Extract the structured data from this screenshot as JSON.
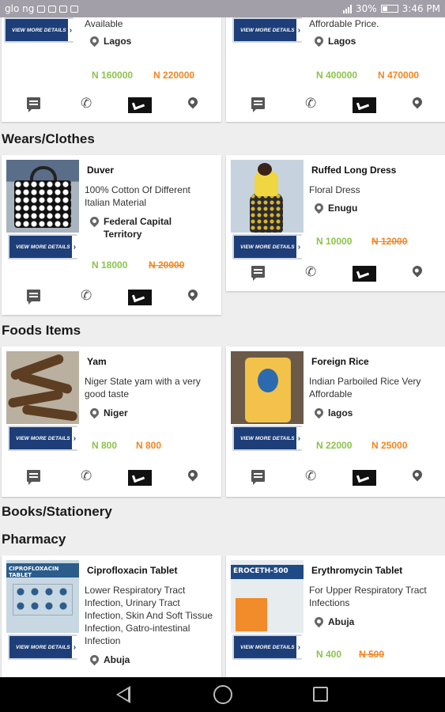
{
  "status_bar": {
    "carrier": "glo ng",
    "battery": "30%",
    "time": "3:46 PM"
  },
  "view_more_label": "VIEW MORE DETAILS",
  "sections": {
    "wears": "Wears/Clothes",
    "foods": "Foods Items",
    "books": "Books/Stationery",
    "pharmacy": "Pharmacy"
  },
  "top_cards": [
    {
      "desc": "Available",
      "location": "Lagos",
      "price": "N 160000",
      "old_price": "N 220000"
    },
    {
      "desc": "Affordable Price.",
      "location": "Lagos",
      "price": "N 400000",
      "old_price": "N 470000"
    }
  ],
  "wears_cards": [
    {
      "title": "Duver",
      "desc": "100% Cotton Of Different Italian Material",
      "location": "Federal Capital Territory",
      "price": "N 18000",
      "old_price": "N 20000",
      "image": "polka-dot-bag"
    },
    {
      "title": "Ruffed Long Dress",
      "desc": "Floral Dress",
      "location": "Enugu",
      "price": "N 10000",
      "old_price": "N 12000",
      "image": "yellow-dress"
    }
  ],
  "food_cards": [
    {
      "title": "Yam",
      "desc": "Niger State yam with a very good taste",
      "location": "Niger",
      "price": "N 800",
      "old_price": "N 800",
      "image": "yam-tubers"
    },
    {
      "title": "Foreign Rice",
      "desc": "Indian Parboiled Rice Very Affordable",
      "location": "lagos",
      "price": "N 22000",
      "old_price": "N 25000",
      "image": "rice-bag"
    }
  ],
  "pharmacy_cards": [
    {
      "title": "Ciprofloxacin Tablet",
      "desc": "Lower Respiratory Tract Infection, Urinary Tract Infection, Skin And Soft Tissue Infection, Gatro-intestinal Infection",
      "location": "Abuja",
      "image": "cipro-box",
      "image_text": "CIPROFLOXACIN TABLET"
    },
    {
      "title": "Erythromycin Tablet",
      "desc": "For Upper Respiratory Tract Infections",
      "location": "Abuja",
      "price": "N 400",
      "old_price": "N 500",
      "image": "erythromycin-box",
      "image_text": "EROCETH-500"
    }
  ],
  "colors": {
    "price_new": "#8bc34a",
    "price_old": "#f5841f",
    "button_blue": "#1d3e78",
    "status_bar": "#a39fa8"
  }
}
